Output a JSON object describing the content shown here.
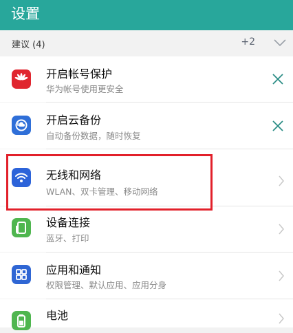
{
  "app_bar": {
    "title": "设置",
    "color": "#28a79b"
  },
  "suggestions": {
    "label": "建议 (4)",
    "extra_count": "+2"
  },
  "items": [
    {
      "title": "开启帐号保护",
      "subtitle": "华为帐号使用更安全",
      "icon": "huawei-logo-icon",
      "action": "close"
    },
    {
      "title": "开启云备份",
      "subtitle": "自动备份数据，随时恢复",
      "icon": "cloud-backup-icon",
      "action": "close"
    },
    {
      "title": "无线和网络",
      "subtitle": "WLAN、双卡管理、移动网络",
      "icon": "wifi-icon",
      "action": "navigate"
    },
    {
      "title": "设备连接",
      "subtitle": "蓝牙、打印",
      "icon": "device-connect-icon",
      "action": "navigate"
    },
    {
      "title": "应用和通知",
      "subtitle": "权限管理、默认应用、应用分身",
      "icon": "apps-icon",
      "action": "navigate"
    },
    {
      "title": "电池",
      "subtitle": "",
      "icon": "battery-icon",
      "action": "navigate"
    }
  ],
  "highlight_color": "#e2202a"
}
